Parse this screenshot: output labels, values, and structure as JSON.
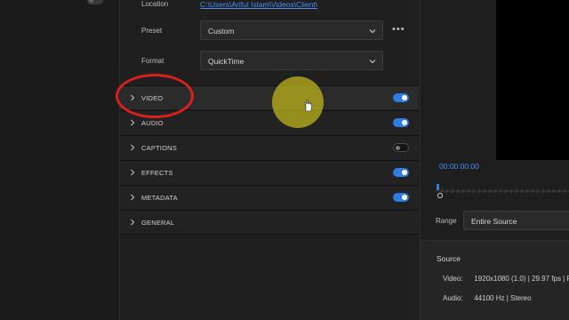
{
  "export": {
    "location": {
      "label": "Location",
      "path": "C:\\Users\\Ariful Islam\\Videos\\Client\\"
    },
    "preset": {
      "label": "Preset",
      "value": "Custom",
      "more_label": "•••"
    },
    "format": {
      "label": "Format",
      "value": "QuickTime"
    }
  },
  "sections": [
    {
      "label": "VIDEO",
      "enabled": true
    },
    {
      "label": "AUDIO",
      "enabled": true
    },
    {
      "label": "CAPTIONS",
      "enabled": false
    },
    {
      "label": "EFFECTS",
      "enabled": true
    },
    {
      "label": "METADATA",
      "enabled": true
    },
    {
      "label": "GENERAL",
      "enabled": null
    }
  ],
  "preview": {
    "timecode": "00:00:00:00",
    "range": {
      "label": "Range",
      "value": "Entire Source"
    }
  },
  "source": {
    "title": "Source",
    "video_label": "Video:",
    "video_value": "1920x1080 (1.0)  |  29.97 fps  |  P",
    "audio_label": "Audio:",
    "audio_value": "44100 Hz  |  Stereo"
  },
  "colors": {
    "accent": "#2f7de1",
    "link": "#4d8ef2",
    "annotation": "#d8201e",
    "cursor_highlight": "#beb41e"
  },
  "icons": [
    "chevron-down-icon",
    "chevron-right-icon",
    "more-icon",
    "hand-cursor-icon",
    "playhead-icon"
  ]
}
